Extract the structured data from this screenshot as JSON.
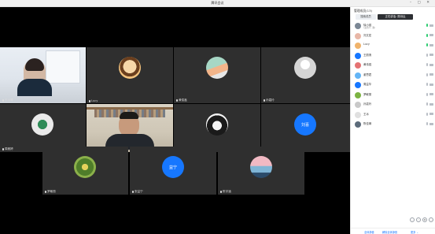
{
  "window": {
    "title": "腾讯会议",
    "controls": "– ▢ ✕"
  },
  "tiles": [
    {
      "id": "t1",
      "name": "王小琴",
      "kind": "video"
    },
    {
      "id": "t2",
      "name": "Lucy",
      "kind": "avatar"
    },
    {
      "id": "t3",
      "name": "黄俊鑫",
      "kind": "avatar"
    },
    {
      "id": "t4",
      "name": "孙嘉玲",
      "kind": "avatar"
    },
    {
      "id": "t5",
      "name": "周雅婷",
      "kind": "avatar"
    },
    {
      "id": "t6",
      "name": "李建国",
      "kind": "video"
    },
    {
      "id": "t7",
      "name": "王冰",
      "kind": "avatar"
    },
    {
      "id": "t8",
      "name": "刘喜峰",
      "kind": "avatar-text",
      "avatar_text": "刘喜"
    },
    {
      "id": "t9",
      "name": "罗敏丽",
      "kind": "avatar"
    },
    {
      "id": "t10",
      "name": "张益宁",
      "kind": "avatar-text",
      "avatar_text": "益宁"
    },
    {
      "id": "t11",
      "name": "陈宇涵",
      "kind": "avatar"
    }
  ],
  "panel": {
    "title": "管理成员(13)",
    "tabs": {
      "inactive": "搜索成员",
      "active": "正在讲话: 周诗弘"
    },
    "members": [
      {
        "name": "徐小强",
        "sub": "(主持人, 我)",
        "color": "#7b8794",
        "mic_color": "#2ecc71"
      },
      {
        "name": "刘文宏",
        "sub": "",
        "color": "#e8b7a7",
        "mic_color": "#2ecc71"
      },
      {
        "name": "Lucy",
        "sub": "",
        "color": "#f0b36b",
        "mic_color": "#2ecc71"
      },
      {
        "name": "王丽清",
        "sub": "",
        "color": "#1677ff",
        "mic_color": "#b9bec6"
      },
      {
        "name": "黄伟强",
        "sub": "",
        "color": "#e57373",
        "mic_color": "#b9bec6"
      },
      {
        "name": "谢思君",
        "sub": "",
        "color": "#64b5f6",
        "mic_color": "#b9bec6"
      },
      {
        "name": "周益华",
        "sub": "",
        "color": "#1677ff",
        "mic_color": "#b9bec6"
      },
      {
        "name": "罗敏丽",
        "sub": "",
        "color": "#7cb342",
        "mic_color": "#b9bec6"
      },
      {
        "name": "孙嘉玲",
        "sub": "",
        "color": "#c9c9c9",
        "mic_color": "#b9bec6"
      },
      {
        "name": "王冰",
        "sub": "",
        "color": "#e0e0e0",
        "mic_color": "#b9bec6"
      },
      {
        "name": "陈佳琳",
        "sub": "",
        "color": "#5c6b7a",
        "mic_color": "#b9bec6"
      }
    ],
    "toolbar_icons": [
      "minimize-icon",
      "pin-icon",
      "settings-icon",
      "more-icon"
    ],
    "footer": {
      "mute_all": "全体静音",
      "unmute_all": "解除全体静音",
      "more": "更多 ⌄"
    }
  }
}
